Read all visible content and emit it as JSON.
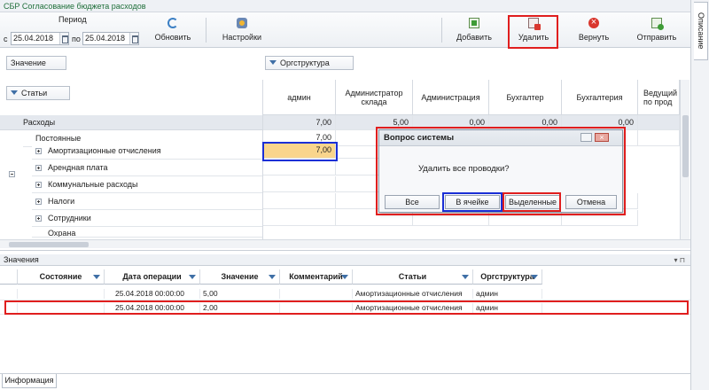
{
  "window_title": "СБР Согласование бюджета расходов",
  "toolbar": {
    "period_label": "Период",
    "from_prefix": "с",
    "from_date": "25.04.2018",
    "to_prefix": "по",
    "to_date": "25.04.2018",
    "refresh_label": "Обновить",
    "settings_label": "Настройки",
    "add_label": "Добавить",
    "delete_label": "Удалить",
    "return_label": "Вернуть",
    "send_label": "Отправить"
  },
  "side_tab": {
    "label": "Описание"
  },
  "pivot": {
    "data_field": "Значение",
    "column_field": "Оргструктура",
    "row_field": "Статьи",
    "columns": [
      "админ",
      "Администратор склада",
      "Администрация",
      "Бухгалтер",
      "Бухгалтерия",
      "Ведущий по прод"
    ],
    "total_row": {
      "label": "Расходы",
      "values": [
        "7,00",
        "5,00",
        "0,00",
        "0,00",
        "0,00",
        ""
      ]
    },
    "group_row": {
      "label": "Постоянные",
      "values": [
        "7,00",
        "",
        "",
        "",
        "",
        ""
      ]
    },
    "rows": [
      {
        "label": "Амортизационные отчисления",
        "values": [
          "7,00",
          "",
          "",
          "",
          "",
          ""
        ]
      },
      {
        "label": "Арендная плата",
        "values": [
          "",
          "",
          "",
          "",
          "",
          ""
        ]
      },
      {
        "label": "Коммунальные расходы",
        "values": [
          "",
          "",
          "",
          "",
          "",
          ""
        ]
      },
      {
        "label": "Налоги",
        "values": [
          "",
          "",
          "",
          "",
          "",
          ""
        ]
      },
      {
        "label": "Сотрудники",
        "values": [
          "",
          "",
          "",
          "",
          "",
          ""
        ]
      },
      {
        "label": "Охрана",
        "values": [
          "",
          "",
          "",
          "",
          "",
          ""
        ]
      }
    ]
  },
  "panel": {
    "caption": "Значения",
    "columns": [
      "Состояние",
      "Дата операции",
      "Значение",
      "Комментарий",
      "Статьи",
      "Оргструктура"
    ],
    "rows": [
      {
        "status": "",
        "date": "25.04.2018 00:00:00",
        "value": "5,00",
        "comment": "",
        "article": "Амортизационные отчисления",
        "org": "админ"
      },
      {
        "status": "",
        "date": "25.04.2018 00:00:00",
        "value": "2,00",
        "comment": "",
        "article": "Амортизационные отчисления",
        "org": "админ"
      }
    ]
  },
  "info_tab": {
    "label": "Информация"
  },
  "dialog": {
    "title": "Вопрос системы",
    "message": "Удалить все проводки?",
    "buttons": {
      "all": "Все",
      "in_cell": "В ячейке",
      "selected": "Выделенные",
      "cancel": "Отмена"
    }
  },
  "colors": {
    "highlight_red": "#e01e1e",
    "highlight_blue": "#1a2fd6",
    "selected_cell": "#f9d58c",
    "title_green": "#1f6f3a"
  }
}
